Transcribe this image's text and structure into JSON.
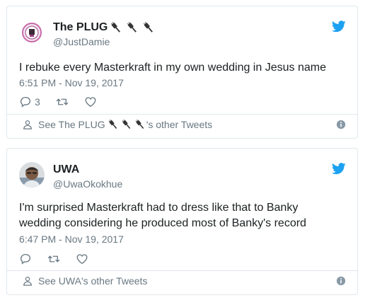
{
  "colors": {
    "text": "#1c2022",
    "secondary": "#697882",
    "twitter_blue": "#1da1f2",
    "border": "#e1e8ed"
  },
  "tweets": [
    {
      "display_name": "The PLUG",
      "name_icons": [
        "plug-icon",
        "plug-icon",
        "plug-icon"
      ],
      "handle": "@JustDamie",
      "text": "I rebuke every Masterkraft in my own wedding in Jesus name",
      "timestamp": "6:51 PM - Nov 19, 2017",
      "reply_count": "3",
      "footer_prefix": "See The PLUG",
      "footer_suffix": "'s other Tweets"
    },
    {
      "display_name": "UWA",
      "handle": "@UwaOkokhue",
      "text_line1": "I'm surprised Masterkraft had to dress like that to Banky",
      "text_line2": "wedding considering he produced most of Banky's record",
      "timestamp": "6:47 PM - Nov 19, 2017",
      "footer_text": "See UWA's other Tweets"
    }
  ]
}
